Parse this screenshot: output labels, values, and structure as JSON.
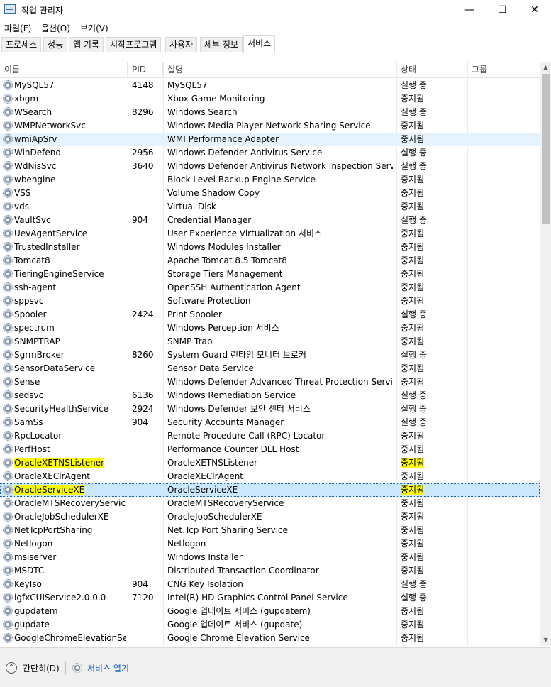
{
  "window": {
    "title": "작업 관리자",
    "minimize": "—",
    "maximize": "☐",
    "close": "✕"
  },
  "menu": [
    "파일(F)",
    "옵션(O)",
    "보기(V)"
  ],
  "tabs": [
    "프로세스",
    "성능",
    "앱 기록",
    "시작프로그램",
    "사용자",
    "세부 정보",
    "서비스"
  ],
  "active_tab": "서비스",
  "columns": {
    "name": "이름",
    "pid": "PID",
    "desc": "설명",
    "status": "상태",
    "group": "그룹",
    "sort_indicator": "^"
  },
  "rows": [
    {
      "name": "MySQL57",
      "pid": "4148",
      "desc": "MySQL57",
      "status": "실행 중"
    },
    {
      "name": "xbgm",
      "pid": "",
      "desc": "Xbox Game Monitoring",
      "status": "중지됨"
    },
    {
      "name": "WSearch",
      "pid": "8296",
      "desc": "Windows Search",
      "status": "실행 중"
    },
    {
      "name": "WMPNetworkSvc",
      "pid": "",
      "desc": "Windows Media Player Network Sharing Service",
      "status": "중지됨"
    },
    {
      "name": "wmiApSrv",
      "pid": "",
      "desc": "WMI Performance Adapter",
      "status": "중지됨",
      "state": "hover"
    },
    {
      "name": "WinDefend",
      "pid": "2956",
      "desc": "Windows Defender Antivirus Service",
      "status": "실행 중"
    },
    {
      "name": "WdNisSvc",
      "pid": "3640",
      "desc": "Windows Defender Antivirus Network Inspection Service",
      "status": "실행 중"
    },
    {
      "name": "wbengine",
      "pid": "",
      "desc": "Block Level Backup Engine Service",
      "status": "중지됨"
    },
    {
      "name": "VSS",
      "pid": "",
      "desc": "Volume Shadow Copy",
      "status": "중지됨"
    },
    {
      "name": "vds",
      "pid": "",
      "desc": "Virtual Disk",
      "status": "중지됨"
    },
    {
      "name": "VaultSvc",
      "pid": "904",
      "desc": "Credential Manager",
      "status": "실행 중"
    },
    {
      "name": "UevAgentService",
      "pid": "",
      "desc": "User Experience Virtualization 서비스",
      "status": "중지됨"
    },
    {
      "name": "TrustedInstaller",
      "pid": "",
      "desc": "Windows Modules Installer",
      "status": "중지됨"
    },
    {
      "name": "Tomcat8",
      "pid": "",
      "desc": "Apache Tomcat 8.5 Tomcat8",
      "status": "중지됨"
    },
    {
      "name": "TieringEngineService",
      "pid": "",
      "desc": "Storage Tiers Management",
      "status": "중지됨"
    },
    {
      "name": "ssh-agent",
      "pid": "",
      "desc": "OpenSSH Authentication Agent",
      "status": "중지됨"
    },
    {
      "name": "sppsvc",
      "pid": "",
      "desc": "Software Protection",
      "status": "중지됨"
    },
    {
      "name": "Spooler",
      "pid": "2424",
      "desc": "Print Spooler",
      "status": "실행 중"
    },
    {
      "name": "spectrum",
      "pid": "",
      "desc": "Windows Perception 서비스",
      "status": "중지됨"
    },
    {
      "name": "SNMPTRAP",
      "pid": "",
      "desc": "SNMP Trap",
      "status": "중지됨"
    },
    {
      "name": "SgrmBroker",
      "pid": "8260",
      "desc": "System Guard 런타임 모니터 브로커",
      "status": "실행 중"
    },
    {
      "name": "SensorDataService",
      "pid": "",
      "desc": "Sensor Data Service",
      "status": "중지됨"
    },
    {
      "name": "Sense",
      "pid": "",
      "desc": "Windows Defender Advanced Threat Protection Service",
      "status": "중지됨"
    },
    {
      "name": "sedsvc",
      "pid": "6136",
      "desc": "Windows Remediation Service",
      "status": "실행 중"
    },
    {
      "name": "SecurityHealthService",
      "pid": "2924",
      "desc": "Windows Defender 보안 센터 서비스",
      "status": "실행 중"
    },
    {
      "name": "SamSs",
      "pid": "904",
      "desc": "Security Accounts Manager",
      "status": "실행 중"
    },
    {
      "name": "RpcLocator",
      "pid": "",
      "desc": "Remote Procedure Call (RPC) Locator",
      "status": "중지됨"
    },
    {
      "name": "PerfHost",
      "pid": "",
      "desc": "Performance Counter DLL Host",
      "status": "중지됨"
    },
    {
      "name": "OracleXETNSListener",
      "pid": "",
      "desc": "OracleXETNSListener",
      "status": "중지됨",
      "highlight": true
    },
    {
      "name": "OracleXEClrAgent",
      "pid": "",
      "desc": "OracleXEClrAgent",
      "status": "중지됨"
    },
    {
      "name": "OracleServiceXE",
      "pid": "",
      "desc": "OracleServiceXE",
      "status": "중지됨",
      "highlight": true,
      "state": "selected"
    },
    {
      "name": "OracleMTSRecoveryService",
      "pid": "",
      "desc": "OracleMTSRecoveryService",
      "status": "중지됨"
    },
    {
      "name": "OracleJobSchedulerXE",
      "pid": "",
      "desc": "OracleJobSchedulerXE",
      "status": "중지됨"
    },
    {
      "name": "NetTcpPortSharing",
      "pid": "",
      "desc": "Net.Tcp Port Sharing Service",
      "status": "중지됨"
    },
    {
      "name": "Netlogon",
      "pid": "",
      "desc": "Netlogon",
      "status": "중지됨"
    },
    {
      "name": "msiserver",
      "pid": "",
      "desc": "Windows Installer",
      "status": "중지됨"
    },
    {
      "name": "MSDTC",
      "pid": "",
      "desc": "Distributed Transaction Coordinator",
      "status": "중지됨"
    },
    {
      "name": "KeyIso",
      "pid": "904",
      "desc": "CNG Key Isolation",
      "status": "실행 중"
    },
    {
      "name": "igfxCUIService2.0.0.0",
      "pid": "7120",
      "desc": "Intel(R) HD Graphics Control Panel Service",
      "status": "실행 중"
    },
    {
      "name": "gupdatem",
      "pid": "",
      "desc": "Google 업데이트 서비스 (gupdatem)",
      "status": "중지됨"
    },
    {
      "name": "gupdate",
      "pid": "",
      "desc": "Google 업데이트 서비스 (gupdate)",
      "status": "중지됨"
    },
    {
      "name": "GoogleChromeElevationSe...",
      "pid": "",
      "desc": "Google Chrome Elevation Service",
      "status": "중지됨"
    }
  ],
  "footer": {
    "collapse": "간단히(D)",
    "open_services": "서비스 열기"
  },
  "colors": {
    "highlight": "#ffff00",
    "selected": "#cce8ff",
    "hover": "#e5f3ff",
    "link": "#0b63ce"
  }
}
